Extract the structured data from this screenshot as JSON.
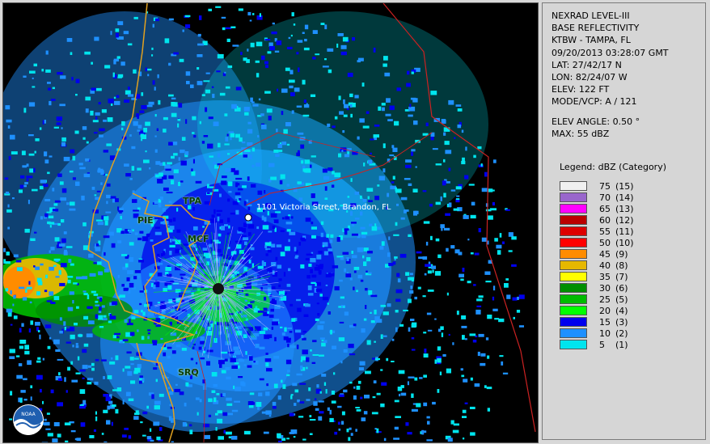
{
  "info": {
    "line1": "NEXRAD LEVEL-III",
    "line2": "BASE REFLECTIVITY",
    "station": "KTBW - TAMPA, FL",
    "datetime": "09/20/2013 03:28:07 GMT",
    "lat": "LAT: 27/42/17 N",
    "lon": "LON: 82/24/07 W",
    "elev": "ELEV: 122 FT",
    "mode": "MODE/VCP: A / 121",
    "elev_angle": "ELEV ANGLE: 0.50 °",
    "max": "MAX: 55 dBZ"
  },
  "legend_title": "Legend: dBZ (Category)",
  "legend": [
    {
      "dbz": "75",
      "cat": "(15)",
      "color": "#f0f0f0"
    },
    {
      "dbz": "70",
      "cat": "(14)",
      "color": "#9966cc"
    },
    {
      "dbz": "65",
      "cat": "(13)",
      "color": "#ff00ff"
    },
    {
      "dbz": "60",
      "cat": "(12)",
      "color": "#bb0000"
    },
    {
      "dbz": "55",
      "cat": "(11)",
      "color": "#dd0000"
    },
    {
      "dbz": "50",
      "cat": "(10)",
      "color": "#ff0000"
    },
    {
      "dbz": "45",
      "cat": "(9)",
      "color": "#ff8c00"
    },
    {
      "dbz": "40",
      "cat": "(8)",
      "color": "#e6b800"
    },
    {
      "dbz": "35",
      "cat": "(7)",
      "color": "#ffff00"
    },
    {
      "dbz": "30",
      "cat": "(6)",
      "color": "#008f00"
    },
    {
      "dbz": "25",
      "cat": "(5)",
      "color": "#00bb00"
    },
    {
      "dbz": "20",
      "cat": "(4)",
      "color": "#00ff00"
    },
    {
      "dbz": "15",
      "cat": "(3)",
      "color": "#0000ee"
    },
    {
      "dbz": "10",
      "cat": "(2)",
      "color": "#1e90ff"
    },
    {
      "dbz": "5",
      "cat": "(1)",
      "color": "#00e5ee"
    }
  ],
  "map": {
    "cities": [
      "TPA",
      "PIE",
      "MCF",
      "SRQ"
    ],
    "address": "1101 Victoria Street, Brandon, FL",
    "logo_text": "NOAA"
  }
}
